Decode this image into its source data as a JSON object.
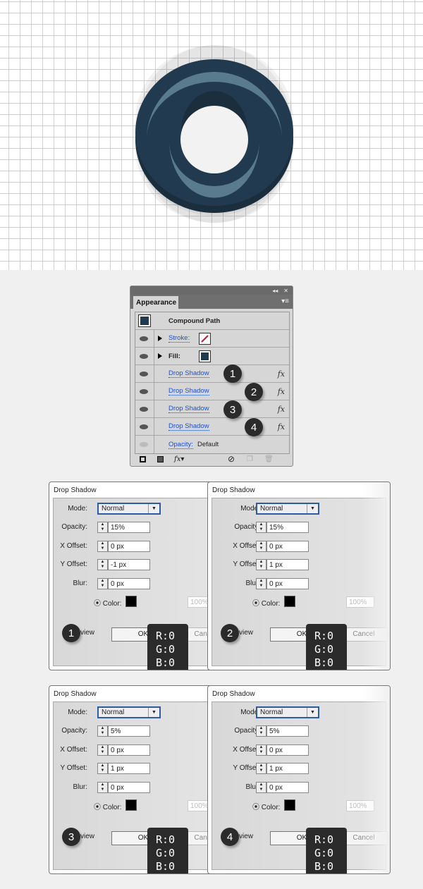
{
  "panel": {
    "title": "Appearance",
    "object": "Compound Path",
    "stroke_label": "Stroke:",
    "fill_label": "Fill:",
    "effect_label": "Drop Shadow",
    "fx": "fx",
    "opacity_label": "Opacity:",
    "opacity_value": "Default",
    "fill_color": "#223a4f",
    "stroke_color": "#d0103a"
  },
  "badges": [
    "1",
    "2",
    "3",
    "4"
  ],
  "dialogs": [
    {
      "title": "Drop Shadow",
      "mode_label": "Mode:",
      "mode": "Normal",
      "opacity_label": "Opacity:",
      "opacity": "15%",
      "x_label": "X Offset:",
      "x": "0 px",
      "y_label": "Y Offset:",
      "y": "-1 px",
      "blur_label": "Blur:",
      "blur": "0 px",
      "color_label": "Color:",
      "darkness": "100%",
      "preview": "view",
      "ok": "OK",
      "cancel": "Cancel",
      "badge": "1",
      "r": "R:0",
      "g": "G:0",
      "b": "B:0"
    },
    {
      "title": "Drop Shadow",
      "mode_label": "Mode:",
      "mode": "Normal",
      "opacity_label": "Opacity:",
      "opacity": "15%",
      "x_label": "X Offset:",
      "x": "0 px",
      "y_label": "Y Offset:",
      "y": "1 px",
      "blur_label": "Blur:",
      "blur": "0 px",
      "color_label": "Color:",
      "darkness": "100%",
      "preview": "view",
      "ok": "OK",
      "cancel": "Cancel",
      "badge": "2",
      "r": "R:0",
      "g": "G:0",
      "b": "B:0"
    },
    {
      "title": "Drop Shadow",
      "mode_label": "Mode:",
      "mode": "Normal",
      "opacity_label": "Opacity:",
      "opacity": "5%",
      "x_label": "X Offset:",
      "x": "0 px",
      "y_label": "Y Offset:",
      "y": "1 px",
      "blur_label": "Blur:",
      "blur": "0 px",
      "color_label": "Color:",
      "darkness": "100%",
      "preview": "view",
      "ok": "OK",
      "cancel": "Cancel",
      "badge": "3",
      "r": "R:0",
      "g": "G:0",
      "b": "B:0"
    },
    {
      "title": "Drop Shadow",
      "mode_label": "Mode:",
      "mode": "Normal",
      "opacity_label": "Opacity:",
      "opacity": "5%",
      "x_label": "X Offset:",
      "x": "0 px",
      "y_label": "Y Offset:",
      "y": "1 px",
      "blur_label": "Blur:",
      "blur": "0 px",
      "color_label": "Color:",
      "darkness": "100%",
      "preview": "view",
      "ok": "OK",
      "cancel": "Cancel",
      "badge": "4",
      "r": "R:0",
      "g": "G:0",
      "b": "B:0"
    }
  ]
}
